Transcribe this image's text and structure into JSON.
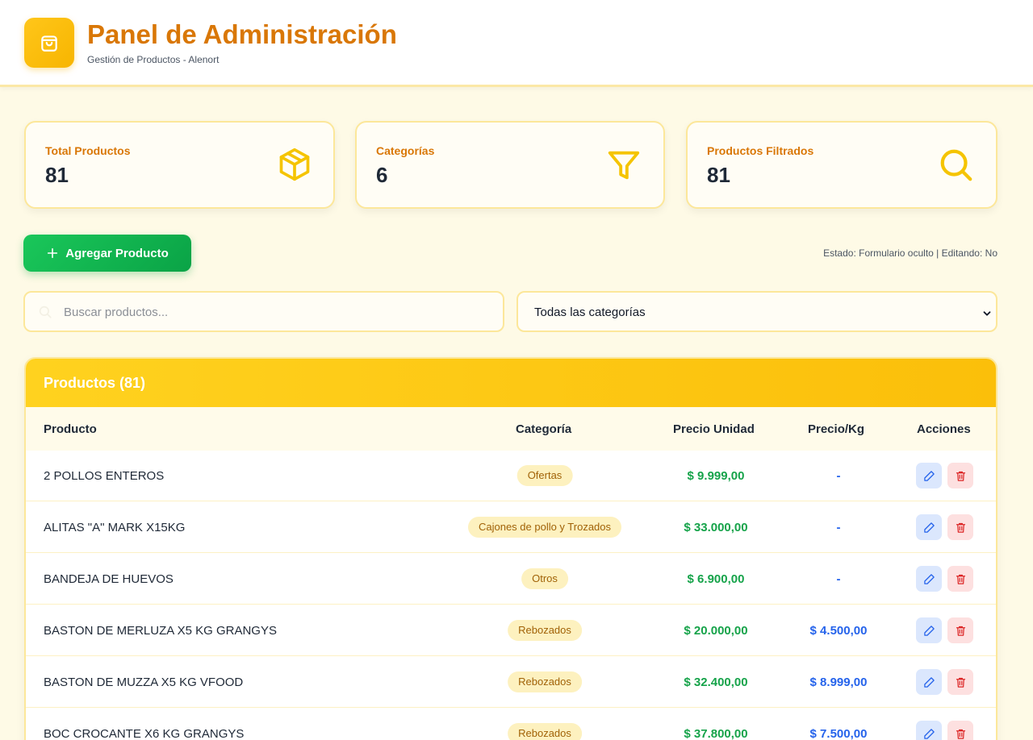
{
  "header": {
    "title": "Panel de Administración",
    "subtitle": "Gestión de Productos - Alenort",
    "logo_icon": "shopping-bag-icon"
  },
  "stats": [
    {
      "label": "Total Productos",
      "value": "81",
      "icon": "box-icon"
    },
    {
      "label": "Categorías",
      "value": "6",
      "icon": "filter-icon"
    },
    {
      "label": "Productos Filtrados",
      "value": "81",
      "icon": "search-icon"
    }
  ],
  "actions": {
    "add_label": "Agregar Producto",
    "status_text": "Estado: Formulario oculto | Editando: No"
  },
  "filters": {
    "search_placeholder": "Buscar productos...",
    "search_value": "",
    "category_selected": "Todas las categorías"
  },
  "table": {
    "title": "Productos (81)",
    "headers": {
      "product": "Producto",
      "category": "Categoría",
      "unit_price": "Precio Unidad",
      "price_kg": "Precio/Kg",
      "actions": "Acciones"
    },
    "rows": [
      {
        "name": "2 POLLOS ENTEROS",
        "category": "Ofertas",
        "unit_price": "$ 9.999,00",
        "price_kg": "-"
      },
      {
        "name": "ALITAS \"A\" MARK X15KG",
        "category": "Cajones de pollo y Trozados",
        "unit_price": "$ 33.000,00",
        "price_kg": "-"
      },
      {
        "name": "BANDEJA DE HUEVOS",
        "category": "Otros",
        "unit_price": "$ 6.900,00",
        "price_kg": "-"
      },
      {
        "name": "BASTON DE MERLUZA X5 KG GRANGYS",
        "category": "Rebozados",
        "unit_price": "$ 20.000,00",
        "price_kg": "$ 4.500,00"
      },
      {
        "name": "BASTON DE MUZZA X5 KG VFOOD",
        "category": "Rebozados",
        "unit_price": "$ 32.400,00",
        "price_kg": "$ 8.999,00"
      },
      {
        "name": "BOC CROCANTE X6 KG GRANGYS",
        "category": "Rebozados",
        "unit_price": "$ 37.800,00",
        "price_kg": "$ 7.500,00"
      }
    ]
  },
  "colors": {
    "accent": "#d97706",
    "header_gradient": "#fbbf0a",
    "price_green": "#16a34a",
    "price_blue": "#2563eb"
  }
}
